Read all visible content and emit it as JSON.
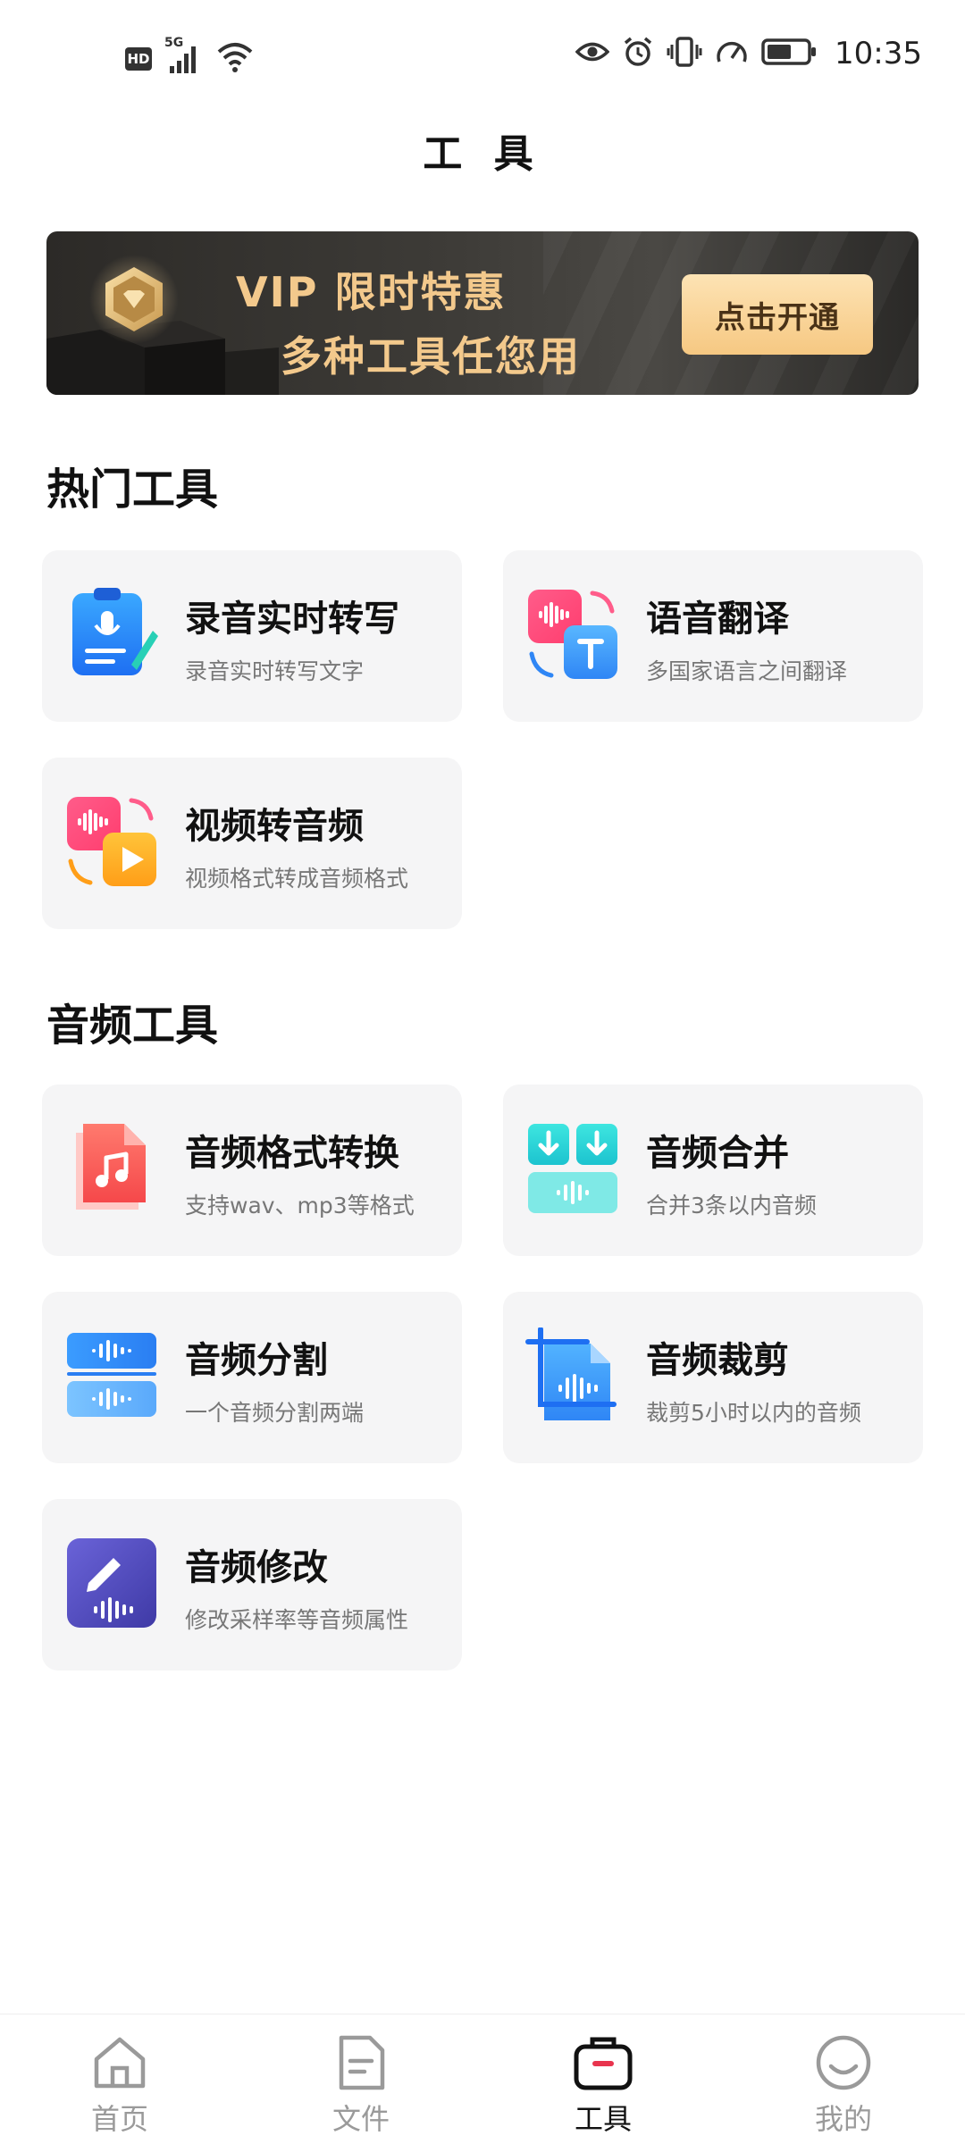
{
  "status_bar": {
    "hd_label": "HD",
    "network_label": "5G",
    "time": "10:35"
  },
  "header": {
    "title": "工 具"
  },
  "banner": {
    "line1": "VIP 限时特惠",
    "line2": "多种工具任您用",
    "button_label": "点击开通",
    "accent_color": "#f3c98c"
  },
  "sections": {
    "hot": {
      "title": "热门工具",
      "cards": [
        {
          "title": "录音实时转写",
          "subtitle": "录音实时转写文字",
          "icon": "clipboard-mic-icon"
        },
        {
          "title": "语音翻译",
          "subtitle": "多国家语言之间翻译",
          "icon": "voice-translate-icon"
        },
        {
          "title": "视频转音频",
          "subtitle": "视频格式转成音频格式",
          "icon": "video-to-audio-icon"
        }
      ]
    },
    "audio": {
      "title": "音频工具",
      "cards": [
        {
          "title": "音频格式转换",
          "subtitle": "支持wav、mp3等格式",
          "icon": "music-file-icon"
        },
        {
          "title": "音频合并",
          "subtitle": "合并3条以内音频",
          "icon": "audio-merge-icon"
        },
        {
          "title": "音频分割",
          "subtitle": "一个音频分割两端",
          "icon": "audio-split-icon"
        },
        {
          "title": "音频裁剪",
          "subtitle": "裁剪5小时以内的音频",
          "icon": "audio-crop-icon"
        },
        {
          "title": "音频修改",
          "subtitle": "修改采样率等音频属性",
          "icon": "audio-edit-icon"
        }
      ]
    }
  },
  "bottom_nav": {
    "items": [
      {
        "label": "首页",
        "icon": "home-icon"
      },
      {
        "label": "文件",
        "icon": "file-icon"
      },
      {
        "label": "工具",
        "icon": "toolbox-icon",
        "active": true
      },
      {
        "label": "我的",
        "icon": "smile-icon"
      }
    ]
  }
}
